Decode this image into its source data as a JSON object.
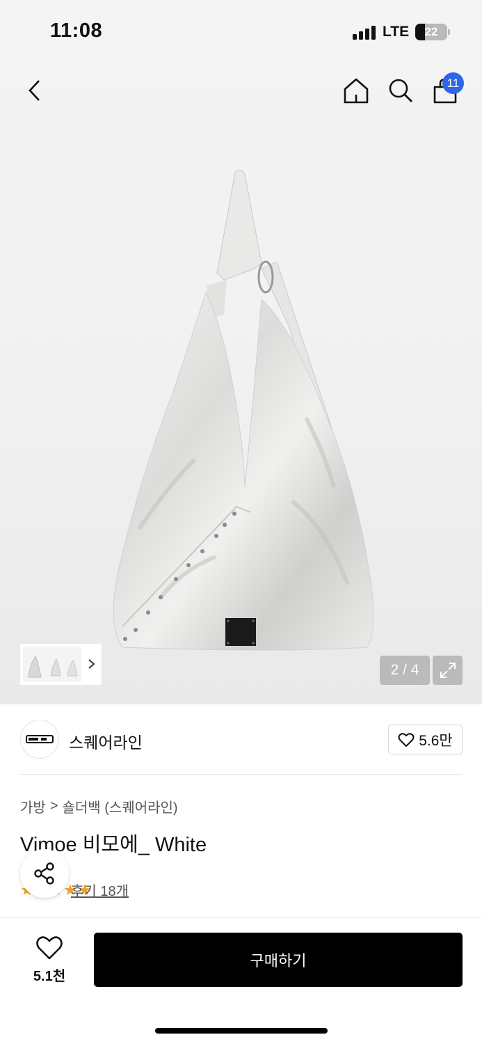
{
  "status_bar": {
    "time": "11:08",
    "network": "LTE",
    "battery": "22"
  },
  "header": {
    "cart_count": "11"
  },
  "gallery": {
    "page_counter": "2 / 4",
    "current_page": 2,
    "total_pages": 4
  },
  "brand": {
    "name": "스퀘어라인",
    "like_count": "5.6만"
  },
  "breadcrumb": {
    "category": "가방",
    "separator": ">",
    "subcategory": "숄더백 (스퀘어라인)"
  },
  "product": {
    "title": "Vimoe 비모에_ White"
  },
  "reviews": {
    "stars": "★★★★★",
    "label": "후기 18개"
  },
  "bottom_bar": {
    "like_count": "5.1천",
    "buy_label": "구매하기"
  },
  "colors": {
    "accent_badge": "#2f66e8",
    "buy_button": "#000000",
    "star": "#f0a020"
  },
  "icons": [
    "back-icon",
    "home-icon",
    "search-icon",
    "cart-icon",
    "chevron-right-icon",
    "expand-icon",
    "heart-icon",
    "share-icon"
  ]
}
